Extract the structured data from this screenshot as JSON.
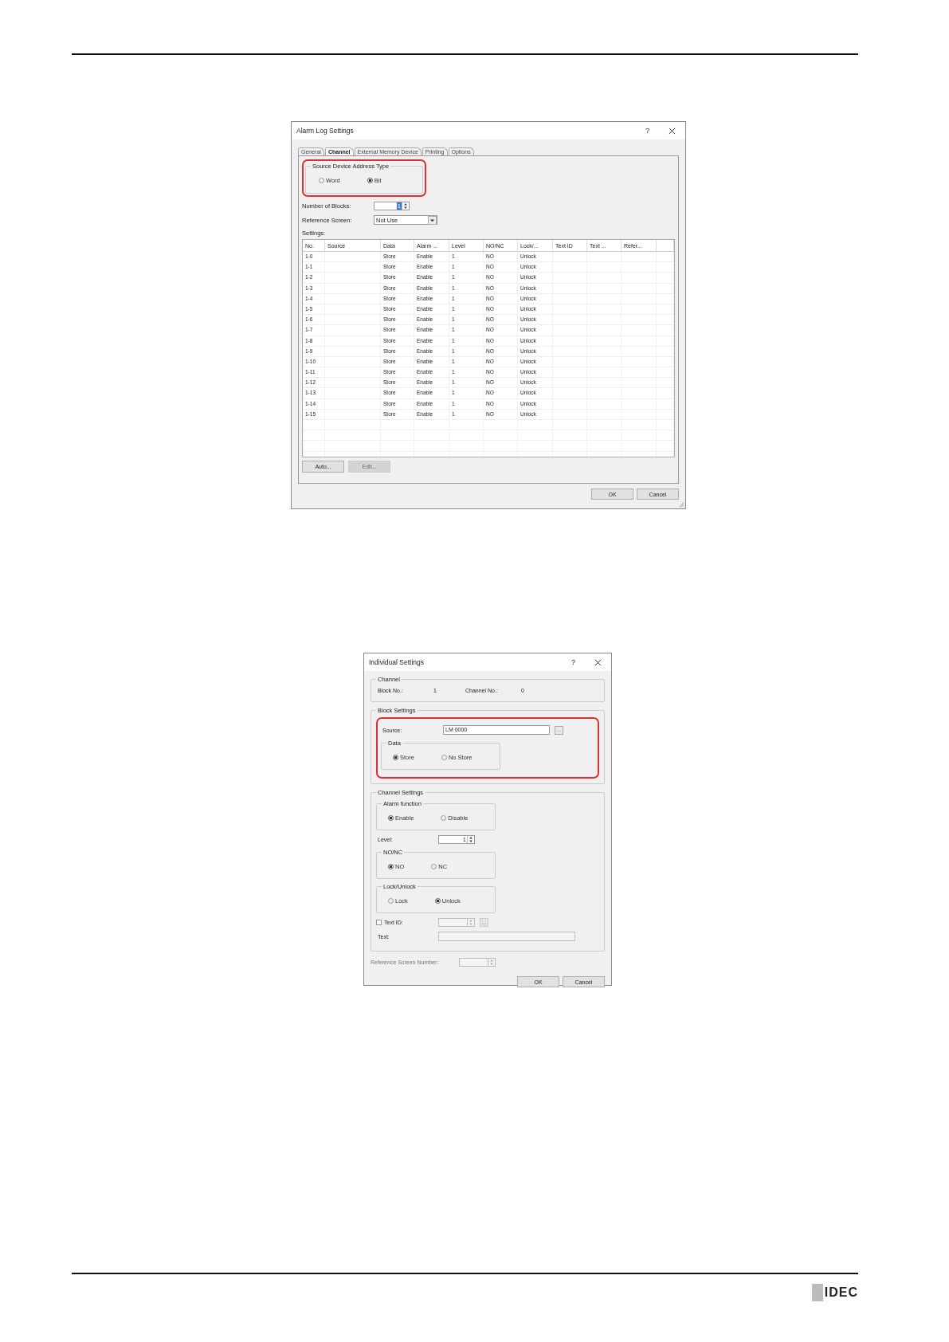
{
  "alarm_log_dialog": {
    "title": "Alarm Log Settings",
    "help": "?",
    "tabs": [
      {
        "label": "General",
        "selected": false
      },
      {
        "label": "Channel",
        "selected": true
      },
      {
        "label": "External Memory Device",
        "selected": false
      },
      {
        "label": "Printing",
        "selected": false
      },
      {
        "label": "Options",
        "selected": false
      }
    ],
    "address_type": {
      "title": "Source Device Address Type",
      "options": [
        {
          "label": "Word",
          "selected": false
        },
        {
          "label": "Bit",
          "selected": true
        }
      ]
    },
    "number_of_blocks": {
      "label": "Number of Blocks:",
      "value": "1"
    },
    "reference_screen": {
      "label": "Reference Screen:",
      "value": "Not Use"
    },
    "settings_label": "Settings:",
    "table": {
      "columns": [
        "No.",
        "Source",
        "Data",
        "Alarm ...",
        "Level",
        "NO/NC",
        "Lock/...",
        "Text ID",
        "Text ...",
        "Refer..."
      ],
      "rows": [
        {
          "no": "1-0",
          "data": "Store",
          "alarm": "Enable",
          "level": "1",
          "no_nc": "NO",
          "lock": "Unlock"
        },
        {
          "no": "1-1",
          "data": "Store",
          "alarm": "Enable",
          "level": "1",
          "no_nc": "NO",
          "lock": "Unlock"
        },
        {
          "no": "1-2",
          "data": "Store",
          "alarm": "Enable",
          "level": "1",
          "no_nc": "NO",
          "lock": "Unlock"
        },
        {
          "no": "1-3",
          "data": "Store",
          "alarm": "Enable",
          "level": "1",
          "no_nc": "NO",
          "lock": "Unlock"
        },
        {
          "no": "1-4",
          "data": "Store",
          "alarm": "Enable",
          "level": "1",
          "no_nc": "NO",
          "lock": "Unlock"
        },
        {
          "no": "1-5",
          "data": "Store",
          "alarm": "Enable",
          "level": "1",
          "no_nc": "NO",
          "lock": "Unlock"
        },
        {
          "no": "1-6",
          "data": "Store",
          "alarm": "Enable",
          "level": "1",
          "no_nc": "NO",
          "lock": "Unlock"
        },
        {
          "no": "1-7",
          "data": "Store",
          "alarm": "Enable",
          "level": "1",
          "no_nc": "NO",
          "lock": "Unlock"
        },
        {
          "no": "1-8",
          "data": "Store",
          "alarm": "Enable",
          "level": "1",
          "no_nc": "NO",
          "lock": "Unlock"
        },
        {
          "no": "1-9",
          "data": "Store",
          "alarm": "Enable",
          "level": "1",
          "no_nc": "NO",
          "lock": "Unlock"
        },
        {
          "no": "1-10",
          "data": "Store",
          "alarm": "Enable",
          "level": "1",
          "no_nc": "NO",
          "lock": "Unlock"
        },
        {
          "no": "1-11",
          "data": "Store",
          "alarm": "Enable",
          "level": "1",
          "no_nc": "NO",
          "lock": "Unlock"
        },
        {
          "no": "1-12",
          "data": "Store",
          "alarm": "Enable",
          "level": "1",
          "no_nc": "NO",
          "lock": "Unlock"
        },
        {
          "no": "1-13",
          "data": "Store",
          "alarm": "Enable",
          "level": "1",
          "no_nc": "NO",
          "lock": "Unlock"
        },
        {
          "no": "1-14",
          "data": "Store",
          "alarm": "Enable",
          "level": "1",
          "no_nc": "NO",
          "lock": "Unlock"
        },
        {
          "no": "1-15",
          "data": "Store",
          "alarm": "Enable",
          "level": "1",
          "no_nc": "NO",
          "lock": "Unlock"
        }
      ]
    },
    "table_buttons": [
      {
        "label": "Auto...",
        "disabled": false
      },
      {
        "label": "Edit...",
        "disabled": true
      }
    ],
    "buttons": [
      "OK",
      "Cancel"
    ]
  },
  "individual_dialog": {
    "title": "Individual Settings",
    "help": "?",
    "channel": {
      "title": "Channel",
      "block_no_label": "Block No.:",
      "block_no": "1",
      "channel_no_label": "Channel No.:",
      "channel_no": "0"
    },
    "block_settings": {
      "title": "Block Settings",
      "source_label": "Source:",
      "source_value": "LM 0000",
      "browse": "...",
      "data": {
        "title": "Data",
        "options": [
          {
            "label": "Store",
            "selected": true
          },
          {
            "label": "No Store",
            "selected": false
          }
        ]
      }
    },
    "channel_settings": {
      "title": "Channel Settings",
      "alarm_function": {
        "title": "Alarm function",
        "options": [
          {
            "label": "Enable",
            "selected": true
          },
          {
            "label": "Disable",
            "selected": false
          }
        ]
      },
      "level": {
        "label": "Level:",
        "value": "1"
      },
      "no_nc": {
        "title": "NO/NC",
        "options": [
          {
            "label": "NO",
            "selected": true
          },
          {
            "label": "NC",
            "selected": false
          }
        ]
      },
      "lock_unlock": {
        "title": "Lock/Unlock",
        "options": [
          {
            "label": "Lock",
            "selected": false
          },
          {
            "label": "Unlock",
            "selected": true
          }
        ]
      },
      "text_id": {
        "label": "Text ID:",
        "checked": false,
        "browse": "..."
      },
      "text": {
        "label": "Text:"
      }
    },
    "reference_screen_number": {
      "label": "Reference Screen Number:"
    },
    "buttons": [
      "OK",
      "Cancel"
    ]
  },
  "footer": {
    "logo": "IDEC"
  }
}
